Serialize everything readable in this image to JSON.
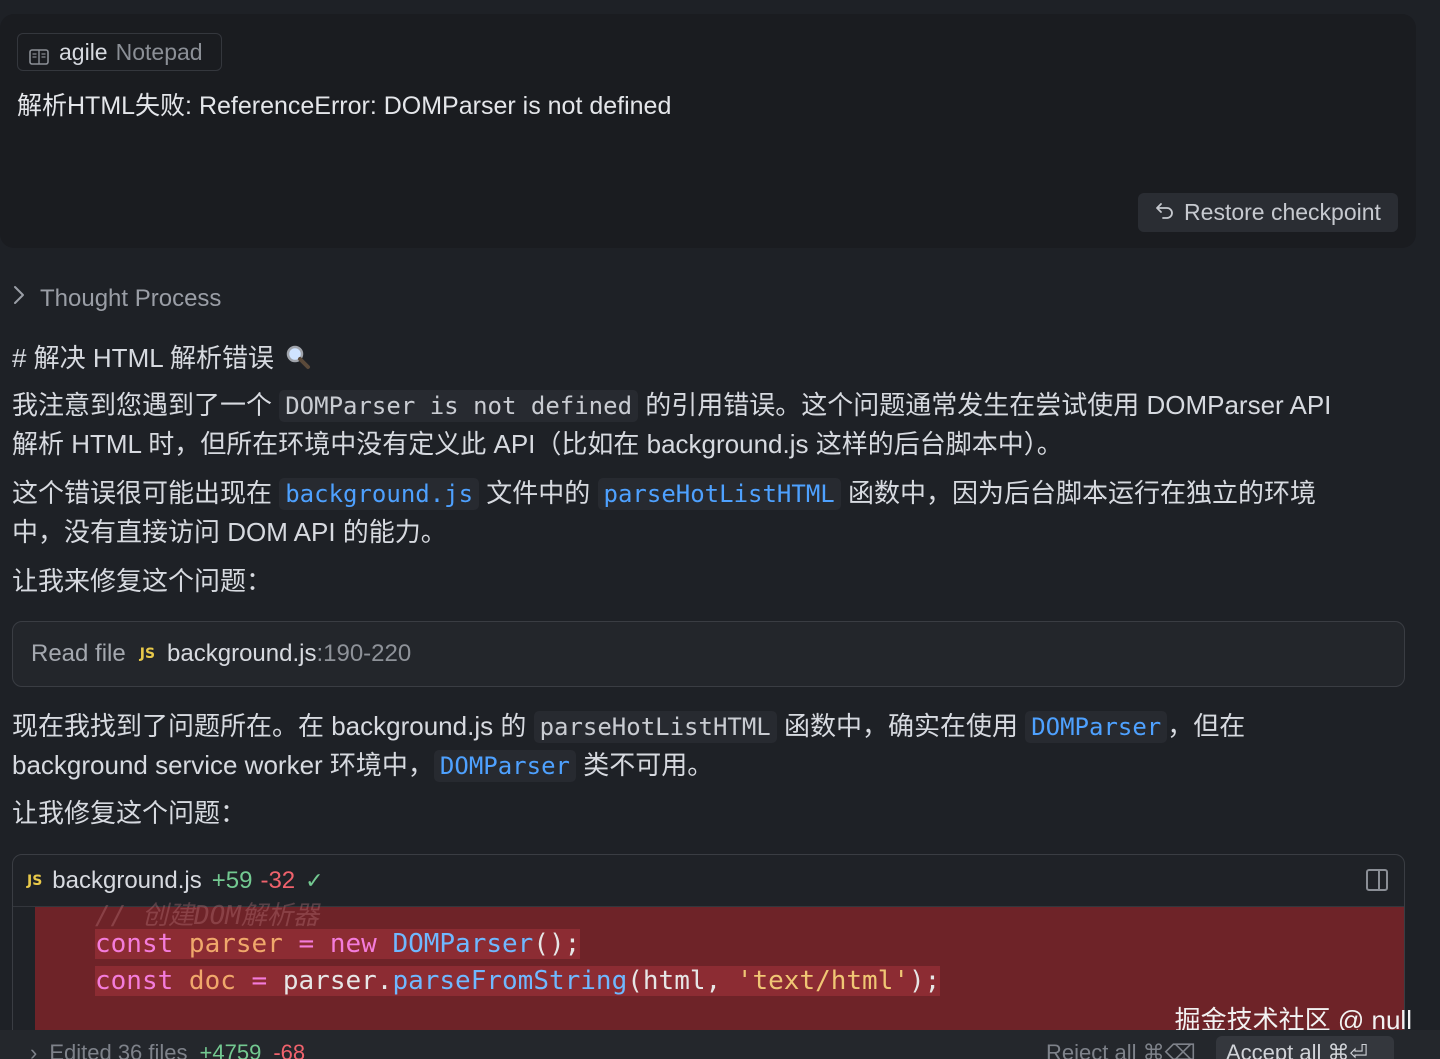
{
  "user": {
    "context_chip": {
      "name": "agile",
      "kind": "Notepad",
      "icon": "notepad-icon"
    },
    "message": "解析HTML失败: ReferenceError: DOMParser is not defined",
    "restore_label": "Restore checkpoint"
  },
  "assistant": {
    "thought_label": "Thought Process",
    "heading": "# 解决 HTML 解析错误",
    "heading_icon": "magnifier-emoji",
    "p1": {
      "before": "我注意到您遇到了一个 ",
      "code": "DOMParser is not defined",
      "after": " 的引用错误。这个问题通常发生在尝试使用 DOMParser API",
      "line2": "解析 HTML 时，但所在环境中没有定义此 API（比如在 background.js 这样的后台脚本中）。"
    },
    "p2": {
      "before": "这个错误很可能出现在 ",
      "code1": "background.js",
      "mid": " 文件中的 ",
      "code2": "parseHotListHTML",
      "after": " 函数中，因为后台脚本运行在独立的环境",
      "line2": "中，没有直接访问 DOM API 的能力。"
    },
    "p3": "让我来修复这个问题：",
    "read_file": {
      "label": "Read file",
      "badge": "JS",
      "file": "background.js",
      "range": ":190-220"
    },
    "p4": {
      "before": "现在我找到了问题所在。在 background.js 的 ",
      "code1": "parseHotListHTML",
      "mid": " 函数中，确实在使用 ",
      "code2": "DOMParser",
      "after": "，但在",
      "line2_before": "background service worker 环境中，",
      "code3": "DOMParser",
      "line2_after": " 类不可用。"
    },
    "p5": "让我修复这个问题：",
    "diff": {
      "badge": "JS",
      "file": "background.js",
      "added": "+59",
      "removed": "-32",
      "check": "✓",
      "code": [
        {
          "text": "// 创建DOM解析器",
          "faded": true
        },
        {
          "tokens": [
            {
              "t": "const ",
              "c": "kw"
            },
            {
              "t": "parser",
              "c": "var"
            },
            {
              "t": " = ",
              "c": "kw"
            },
            {
              "t": "new ",
              "c": "kw"
            },
            {
              "t": "DOMParser",
              "c": "fn"
            },
            {
              "t": "();",
              "c": "plain"
            }
          ]
        },
        {
          "tokens": [
            {
              "t": "const ",
              "c": "kw"
            },
            {
              "t": "doc",
              "c": "var"
            },
            {
              "t": " = ",
              "c": "kw"
            },
            {
              "t": "parser",
              "c": "plain"
            },
            {
              "t": ".",
              "c": "plain"
            },
            {
              "t": "parseFromString",
              "c": "fn"
            },
            {
              "t": "(html, ",
              "c": "plain"
            },
            {
              "t": "'text/html'",
              "c": "str"
            },
            {
              "t": ");",
              "c": "plain"
            }
          ]
        }
      ]
    }
  },
  "footer": {
    "edited": "Edited 36 files",
    "added": "+4759",
    "removed": "-68",
    "reject": "Reject all ⌘⌫",
    "accept": "Accept all ⌘⏎"
  },
  "watermark": "掘金技术社区 @ null"
}
